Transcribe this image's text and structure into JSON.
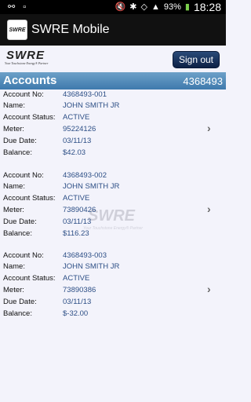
{
  "statusbar": {
    "battery": "93%",
    "time": "18:28"
  },
  "app": {
    "icon_text": "SWRE",
    "title": "SWRE Mobile"
  },
  "header": {
    "logo_mark": "SWRE",
    "logo_tagline": "Your Touchstone Energy® Partner",
    "signout_label": "Sign out"
  },
  "accounts": {
    "title": "Accounts",
    "number": "4368493",
    "labels": {
      "account_no": "Account No:",
      "name": "Name:",
      "status": "Account Status:",
      "meter": "Meter:",
      "due_date": "Due Date:",
      "balance": "Balance:"
    },
    "items": [
      {
        "account_no": "4368493-001",
        "name": "JOHN SMITH JR",
        "status": "ACTIVE",
        "meter": "95224126",
        "due_date": "03/11/13",
        "balance": "$42.03"
      },
      {
        "account_no": "4368493-002",
        "name": "JOHN SMITH JR",
        "status": "ACTIVE",
        "meter": "73890426",
        "due_date": "03/11/13",
        "balance": "$116.23"
      },
      {
        "account_no": "4368493-003",
        "name": "JOHN SMITH JR",
        "status": "ACTIVE",
        "meter": "73890386",
        "due_date": "03/11/13",
        "balance": "$-32.00"
      }
    ]
  },
  "icons": {
    "chevron": "chevron-right-icon"
  }
}
